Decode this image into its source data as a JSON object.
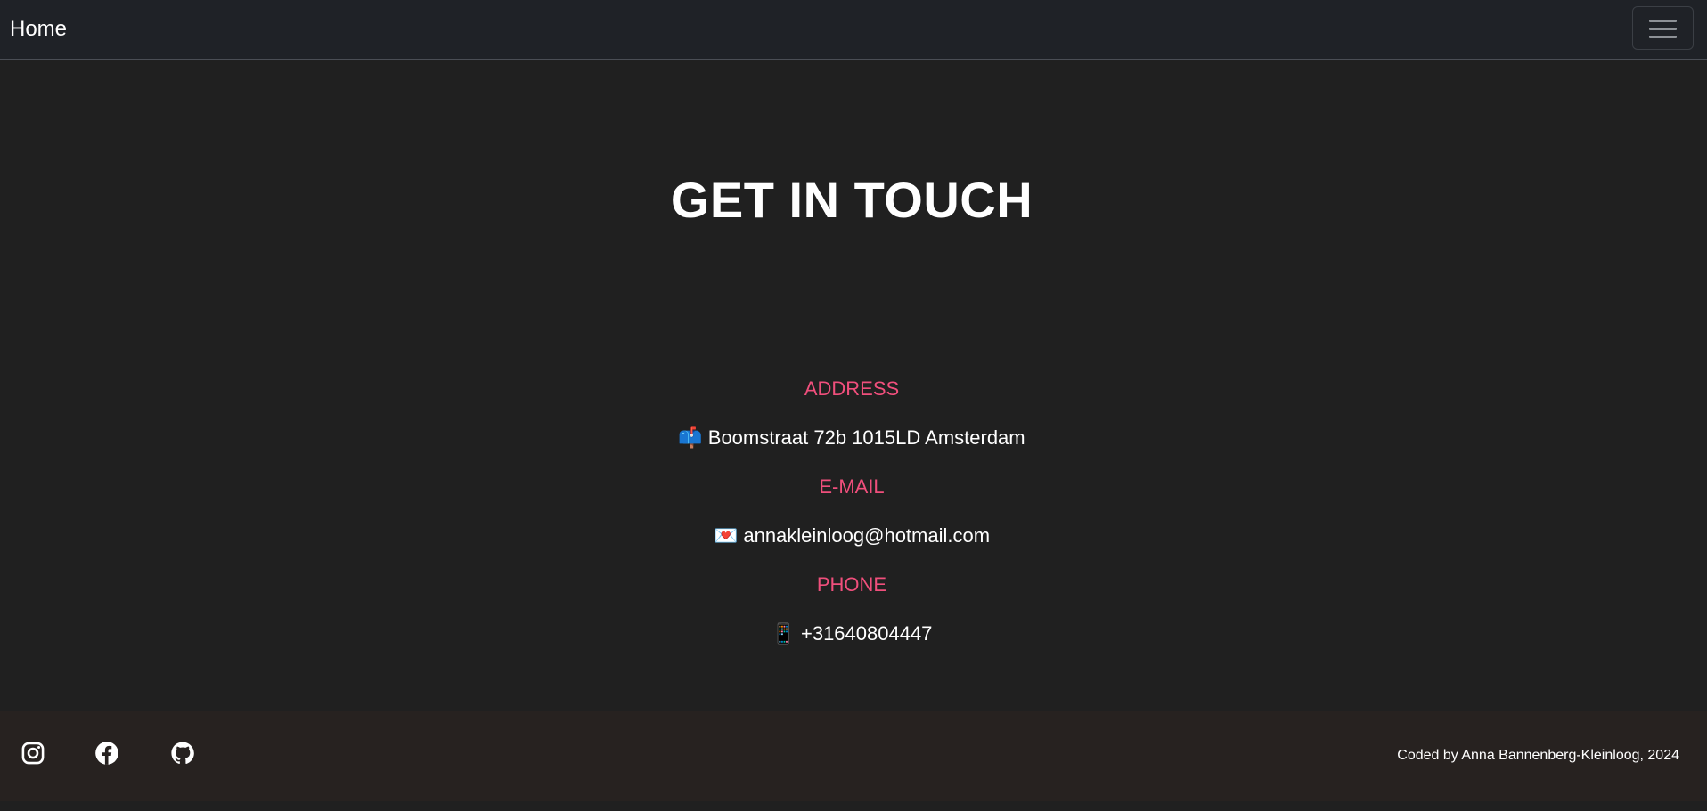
{
  "navbar": {
    "brand": "Home",
    "toggler_icon": "hamburger-menu-icon"
  },
  "main": {
    "title": "GET IN TOUCH",
    "contact": [
      {
        "label": "ADDRESS",
        "icon": "mailbox-emoji",
        "emoji": "📫",
        "value": "Boomstraat 72b 1015LD Amsterdam"
      },
      {
        "label": "E-MAIL",
        "icon": "envelope-emoji",
        "emoji": "💌",
        "value": "annakleinloog@hotmail.com"
      },
      {
        "label": "PHONE",
        "icon": "mobile-phone-emoji",
        "emoji": "📱",
        "value": "+31640804447"
      }
    ]
  },
  "footer": {
    "socials": [
      {
        "name": "instagram-icon"
      },
      {
        "name": "facebook-icon"
      },
      {
        "name": "github-icon"
      }
    ],
    "credit": "Coded by Anna Bannenberg-Kleinloog, 2024"
  },
  "colors": {
    "background": "#202020",
    "navbar": "#1f2227",
    "accent": "#f04f7c",
    "footer": "#272220"
  }
}
